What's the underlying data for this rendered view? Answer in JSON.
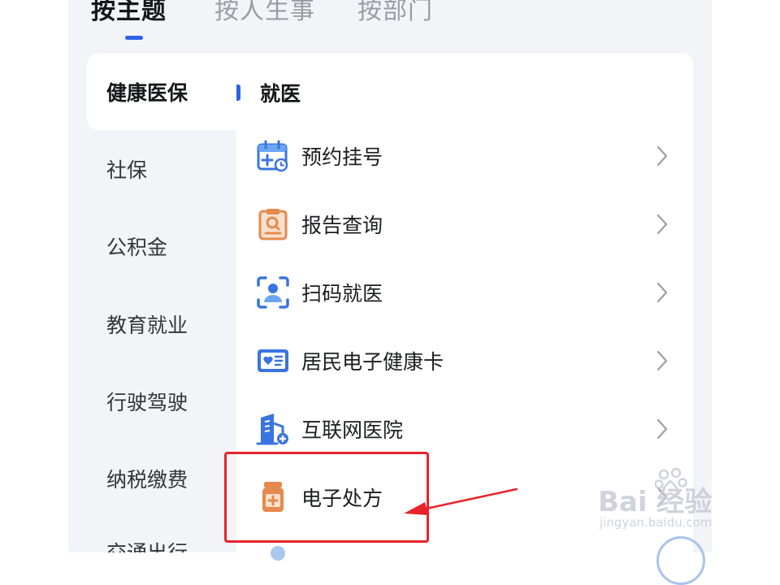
{
  "tabs": {
    "items": [
      {
        "label": "按主题",
        "active": true
      },
      {
        "label": "按人生事",
        "active": false
      },
      {
        "label": "按部门",
        "active": false
      }
    ]
  },
  "sidebar": {
    "items": [
      {
        "label": "健康医保",
        "active": true
      },
      {
        "label": "社保",
        "active": false
      },
      {
        "label": "公积金",
        "active": false
      },
      {
        "label": "教育就业",
        "active": false
      },
      {
        "label": "行驶驾驶",
        "active": false
      },
      {
        "label": "纳税缴费",
        "active": false
      },
      {
        "label": "交通出行",
        "active": false
      }
    ]
  },
  "panel": {
    "section_title": "就医",
    "items": [
      {
        "label": "预约挂号",
        "icon": "calendar-plus-icon"
      },
      {
        "label": "报告查询",
        "icon": "report-search-icon"
      },
      {
        "label": "扫码就医",
        "icon": "scan-person-icon"
      },
      {
        "label": "居民电子健康卡",
        "icon": "health-card-icon"
      },
      {
        "label": "互联网医院",
        "icon": "hospital-building-icon"
      },
      {
        "label": "电子处方",
        "icon": "medicine-bottle-icon"
      }
    ]
  },
  "annotation": {
    "highlight_color": "#e8232a"
  },
  "watermark": {
    "main": "Bai 经验",
    "sub": "jingyan.baidu.com"
  },
  "colors": {
    "accent": "#2f62e8",
    "icon_blue": "#3a74e0",
    "icon_orange": "#e58a4e"
  }
}
